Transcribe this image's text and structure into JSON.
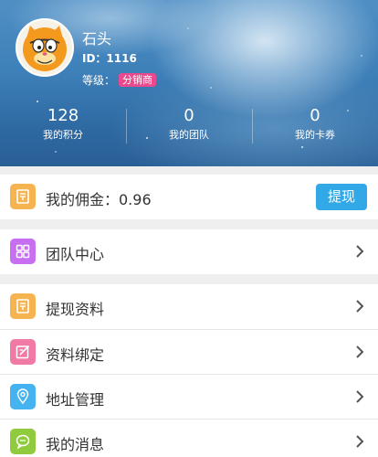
{
  "profile": {
    "name": "石头",
    "id_text": "ID：1116",
    "level_label": "等级：",
    "level_badge": "分销商"
  },
  "stats": [
    {
      "value": "128",
      "label": "我的积分"
    },
    {
      "value": "0",
      "label": "我的团队"
    },
    {
      "value": "0",
      "label": "我的卡券"
    }
  ],
  "commission": {
    "label": "我的佣金：0.96",
    "button": "提现",
    "icon": "wallet-icon",
    "icon_color": "#f6b451"
  },
  "menu": [
    {
      "label": "团队中心",
      "icon": "grid-icon",
      "color": "#c86ef0"
    },
    {
      "label": "提现资料",
      "icon": "document-icon",
      "color": "#f6b451"
    },
    {
      "label": "资料绑定",
      "icon": "edit-icon",
      "color": "#f07aa5"
    },
    {
      "label": "地址管理",
      "icon": "location-icon",
      "color": "#45b3ef"
    },
    {
      "label": "我的消息",
      "icon": "message-icon",
      "color": "#8fcb3d"
    }
  ],
  "colors": {
    "accent": "#32a8e7",
    "badge": "#e94a8e"
  }
}
